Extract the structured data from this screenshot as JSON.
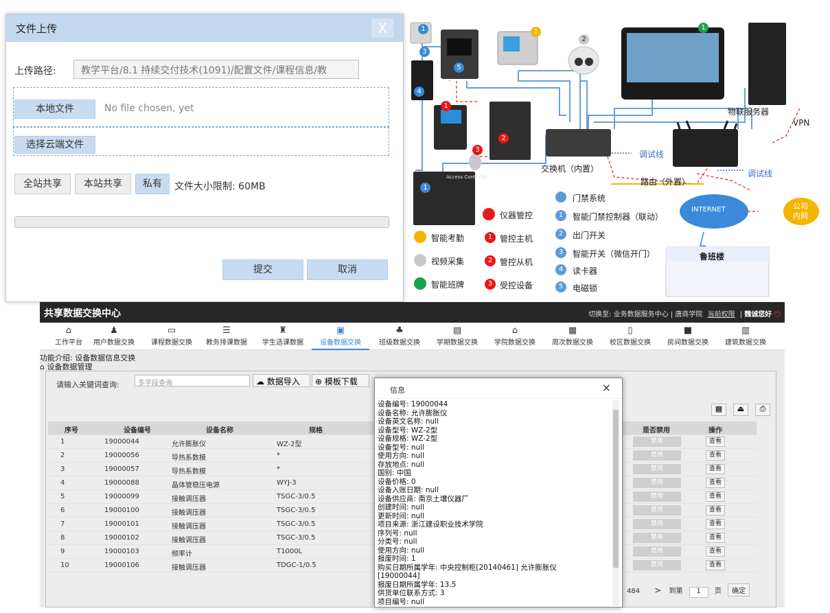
{
  "upload": {
    "title": "文件上传",
    "close": "X",
    "path_label": "上传路径:",
    "path_value": "教学平台/8.1 持续交付技术(1091)/配置文件/课程信息/教",
    "local_btn": "本地文件",
    "no_file": "No file chosen, yet",
    "cloud_btn": "选择云端文件",
    "share_all": "全站共享",
    "share_site": "本站共享",
    "private": "私有",
    "size_limit": "文件大小限制: 60MB",
    "submit": "提交",
    "cancel": "取消"
  },
  "diagram": {
    "labels": {
      "iot_server": "物联服务器",
      "vpn": "VPN",
      "debug1": "调试线",
      "debug2": "调试线",
      "switch": "交换机（内置）",
      "router": "路由（外置）",
      "internet": "INTERNET",
      "company": [
        "公司",
        "内网"
      ],
      "lubanlou": "鲁班楼",
      "controller_label": "Access Controller"
    },
    "legend_left": [
      {
        "label": "仪器管控",
        "color": "#e81818"
      },
      {
        "label": "智能考勤",
        "color": "#f5b400"
      },
      {
        "label": "视频采集",
        "color": "#c8c8c8"
      },
      {
        "label": "智能班牌",
        "color": "#1aa34a"
      }
    ],
    "legend_mid": [
      {
        "num": "1",
        "label": "管控主机"
      },
      {
        "num": "2",
        "label": "管控从机"
      },
      {
        "num": "3",
        "label": "受控设备"
      }
    ],
    "legend_right": [
      {
        "num": "",
        "label": "门禁系统"
      },
      {
        "num": "1",
        "label": "智能门禁控制器（联动）"
      },
      {
        "num": "2",
        "label": "出门开关"
      },
      {
        "num": "3",
        "label": "智能开关（微信开门）"
      },
      {
        "num": "4",
        "label": "读卡器"
      },
      {
        "num": "5",
        "label": "电磁锁"
      }
    ],
    "device_nums": [
      "1",
      "2",
      "3",
      "4",
      "5",
      "1",
      "2",
      "3",
      "1",
      "1",
      "1"
    ]
  },
  "app": {
    "brand": "共享数据交换中心",
    "topright": {
      "switch": "切换至: 业务数据服务中心",
      "school": "唐商学院",
      "perm": "当前权限",
      "greet": "魏诚您好"
    },
    "nav": [
      {
        "icon": "⌂",
        "label": "工作平台"
      },
      {
        "icon": "♟",
        "label": "用户数据交换"
      },
      {
        "icon": "▭",
        "label": "课程数据交换"
      },
      {
        "icon": "☰",
        "label": "教务排课数据"
      },
      {
        "icon": "♜",
        "label": "学生选课数据"
      },
      {
        "icon": "▣",
        "label": "设备数据交换"
      },
      {
        "icon": "♣",
        "label": "班级数据交换"
      },
      {
        "icon": "▤",
        "label": "学期数据交换"
      },
      {
        "icon": "⌂",
        "label": "学院数据交换"
      },
      {
        "icon": "▦",
        "label": "周次数据交换"
      },
      {
        "icon": "▯",
        "label": "校区数据交换"
      },
      {
        "icon": "■",
        "label": "房间数据交换"
      },
      {
        "icon": "▥",
        "label": "建筑数据交换"
      }
    ],
    "intro": "功能介绍: 设备数据信息交换",
    "section": "设备数据管理",
    "search_label": "请输入关键词查询:",
    "search_placeholder": "多字段查询",
    "import_btn": "数据导入",
    "template_btn": "模板下载",
    "headers": [
      "序号",
      "设备编号",
      "设备名称",
      "规格",
      "是否禁用",
      "操作"
    ],
    "rows": [
      [
        "1",
        "19000044",
        "允许膨胀仪",
        "WZ-2型"
      ],
      [
        "2",
        "19000056",
        "导热系数模",
        "*"
      ],
      [
        "3",
        "19000057",
        "导热系数模",
        "*"
      ],
      [
        "4",
        "19000088",
        "晶体管稳压电源",
        "WYJ-3"
      ],
      [
        "5",
        "19000099",
        "接触调压器",
        "TSGC-3/0.5"
      ],
      [
        "6",
        "19000100",
        "接触调压器",
        "TSGC-3/0.5"
      ],
      [
        "7",
        "19000101",
        "接触调压器",
        "TSGC-3/0.5"
      ],
      [
        "8",
        "19000102",
        "接触调压器",
        "TSGC-3/0.5"
      ],
      [
        "9",
        "19000103",
        "频率计",
        "T1000L"
      ],
      [
        "10",
        "19000106",
        "接触调压器",
        "TDGC-1/0.5"
      ]
    ],
    "disable_label": "禁用",
    "view_label": "查看",
    "pager": {
      "total": "484",
      "next": ">",
      "goto": "到第",
      "page": "1",
      "unit": "页",
      "confirm": "确定"
    }
  },
  "modal": {
    "title": "信息",
    "close": "×",
    "lines": [
      "设备编号: 19000044",
      "设备名称: 允许膨胀仪",
      "设备英文名称: null",
      "设备型号: WZ-2型",
      "设备规格: WZ-2型",
      "设备型号: null",
      "使用方向: null",
      "存放地点: null",
      "国别: 中国",
      "设备价格: 0",
      "设备入账日期: null",
      "设备供应商: 南京土壤仪器厂",
      "创建时间: null",
      "更新时间: null",
      "项目来源: 浙江建设职业技术学院",
      "序列号: null",
      "分类号: null",
      "使用方向: null",
      "报废时间: 1",
      "购买日期所属学年: 中央控制柜[20140461] 允许膨胀仪",
      "[19000044]",
      "报废日期所属学年: 13.5",
      "供货单位联系方式: 3",
      "项目编号: null"
    ]
  }
}
